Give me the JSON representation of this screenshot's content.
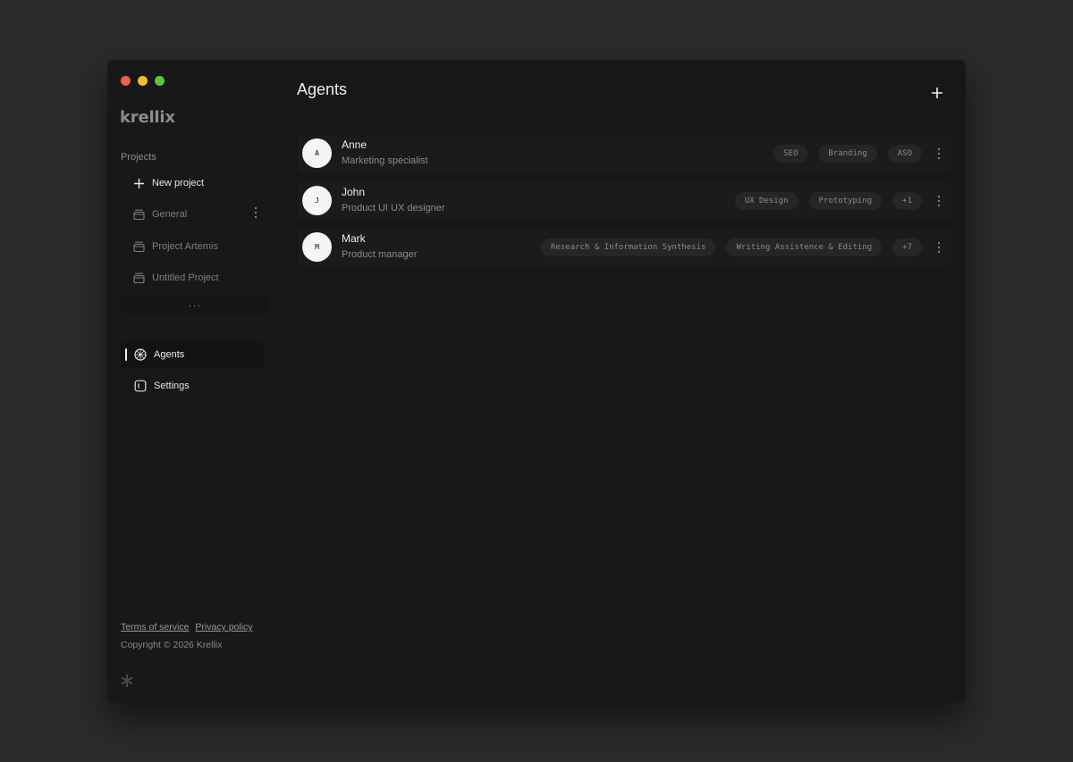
{
  "window": {
    "traffic_lights": [
      "close",
      "minimize",
      "maximize"
    ]
  },
  "sidebar": {
    "logo": "krellix",
    "projects_label": "Projects",
    "new_project": {
      "label": "New project",
      "icon": "plus-icon"
    },
    "projects": [
      {
        "label": "General",
        "icon": "box-icon",
        "has_menu": true
      },
      {
        "label": "Project Artemis",
        "icon": "box-icon"
      },
      {
        "label": "Untitled Project",
        "icon": "box-icon"
      }
    ],
    "more": "...",
    "nav": [
      {
        "label": "Agents",
        "icon": "agents-icon",
        "active": true
      },
      {
        "label": "Settings",
        "icon": "settings-icon",
        "active": false
      }
    ],
    "footer": {
      "terms": "Terms of service",
      "privacy": "Privacy policy",
      "copyright": "Copyright © 2026 Krellix"
    }
  },
  "main": {
    "title": "Agents",
    "add_icon": "plus-icon",
    "agents": [
      {
        "initial": "A",
        "name": "Anne",
        "role": "Marketing specialist",
        "tags": [
          "SEO",
          "Branding",
          "ASO"
        ]
      },
      {
        "initial": "J",
        "name": "John",
        "role": "Product UI UX designer",
        "tags": [
          "UX Design",
          "Prototyping",
          "+1"
        ]
      },
      {
        "initial": "M",
        "name": "Mark",
        "role": "Product manager",
        "tags": [
          "Research & Information Synthesis",
          "Writing Assistence & Editing",
          "+7"
        ]
      }
    ]
  },
  "colors": {
    "background": "#2b2b2b",
    "window": "#171717",
    "row": "#1b1b1b",
    "tag": "#262626",
    "close": "#ee5c54",
    "minimize": "#f0be2f",
    "maximize": "#5dc640"
  }
}
